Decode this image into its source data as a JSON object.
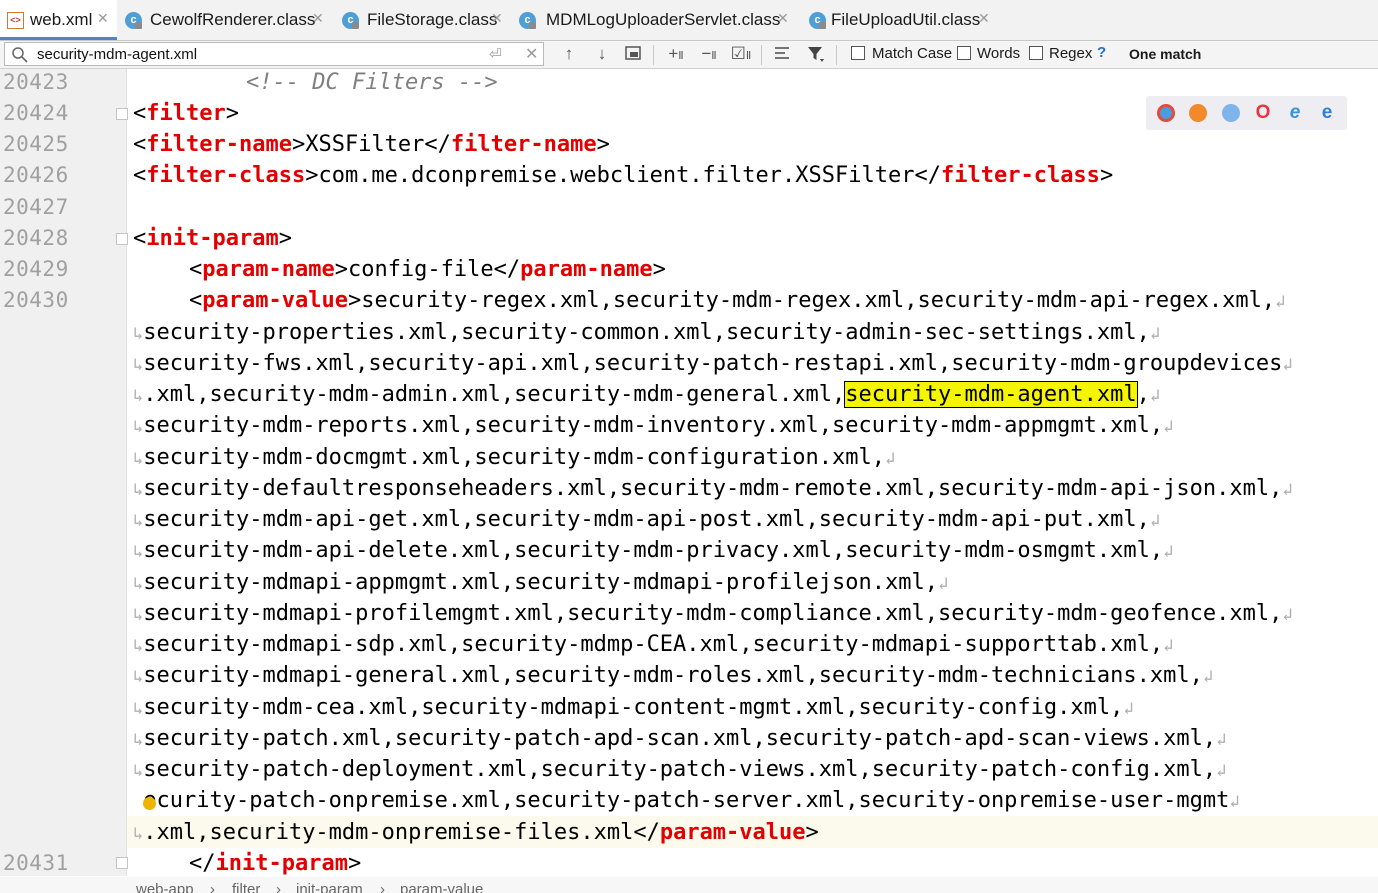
{
  "tabs": [
    {
      "label": "web.xml",
      "icon": "xml-file-icon",
      "active": true
    },
    {
      "label": "CewolfRenderer.class",
      "icon": "class-file-icon",
      "active": false
    },
    {
      "label": "FileStorage.class",
      "icon": "class-file-icon",
      "active": false
    },
    {
      "label": "MDMLogUploaderServlet.class",
      "icon": "class-file-icon",
      "active": false
    },
    {
      "label": "FileUploadUtil.class",
      "icon": "class-file-icon",
      "active": false
    }
  ],
  "find": {
    "query": "security-mdm-agent.xml",
    "match_case_label": "Match Case",
    "words_label": "Words",
    "regex_label": "Regex",
    "help": "?",
    "result": "One match",
    "tool_icons": [
      "arrow-up-icon",
      "arrow-down-icon",
      "select-all-occurrences-icon",
      "add-selection-icon",
      "remove-selection-icon",
      "select-all-icon",
      "multiline-icon",
      "filter-icon"
    ]
  },
  "editor": {
    "line_numbers": [
      "20423",
      "20424",
      "20425",
      "20426",
      "20427",
      "20428",
      "20429",
      "20430",
      "20431"
    ],
    "line_20423": {
      "comment": "<!-- DC Filters -->"
    },
    "line_20424": {
      "open": "<",
      "tag": "filter",
      "close": ">"
    },
    "line_20425": {
      "tag_open": "filter-name",
      "text": "XSSFilter",
      "tag_close": "filter-name"
    },
    "line_20426": {
      "tag_open": "filter-class",
      "text": "com.me.dconpremise.webclient.filter.XSSFilter",
      "tag_close": "filter-class"
    },
    "line_20428": {
      "tag": "init-param"
    },
    "line_20429": {
      "tag_open": "param-name",
      "text": "config-file",
      "tag_close": "param-name"
    },
    "line_20430": {
      "tag_open": "param-value",
      "first": "security-regex.xml,security-mdm-regex.xml,security-mdm-api-regex.xml,",
      "wrapped": [
        "security-properties.xml,security-common.xml,security-admin-sec-settings.xml,",
        "security-fws.xml,security-api.xml,security-patch-restapi.xml,security-mdm-groupdevices",
        ".xml,security-mdm-admin.xml,security-mdm-general.xml,",
        "security-mdm-reports.xml,security-mdm-inventory.xml,security-mdm-appmgmt.xml,",
        "security-mdm-docmgmt.xml,security-mdm-configuration.xml,",
        "security-defaultresponseheaders.xml,security-mdm-remote.xml,security-mdm-api-json.xml,",
        "security-mdm-api-get.xml,security-mdm-api-post.xml,security-mdm-api-put.xml,",
        "security-mdm-api-delete.xml,security-mdm-privacy.xml,security-mdm-osmgmt.xml,",
        "security-mdmapi-appmgmt.xml,security-mdmapi-profilejson.xml,",
        "security-mdmapi-profilemgmt.xml,security-mdm-compliance.xml,security-mdm-geofence.xml,",
        "security-mdmapi-sdp.xml,security-mdmp-CEA.xml,security-mdmapi-supporttab.xml,",
        "security-mdmapi-general.xml,security-mdm-roles.xml,security-mdm-technicians.xml,",
        "security-mdm-cea.xml,security-mdmapi-content-mgmt.xml,security-config.xml,",
        "security-patch.xml,security-patch-apd-scan.xml,security-patch-apd-scan-views.xml,",
        "security-patch-deployment.xml,security-patch-views.xml,security-patch-config.xml,",
        "ecurity-patch-onpremise.xml,security-patch-server.xml,security-onpremise-user-mgmt",
        ".xml,security-mdm-onpremise-files.xml"
      ],
      "match": "security-mdm-agent.xml",
      "after_match": ",",
      "tag_close": "param-value"
    },
    "line_20431": {
      "tag_close": "init-param"
    }
  },
  "browsers": [
    "chrome-icon",
    "firefox-icon",
    "safari-icon",
    "opera-icon",
    "ie-icon",
    "edge-icon"
  ],
  "breadcrumb": [
    "web-app",
    "filter",
    "init-param",
    "param-value"
  ]
}
